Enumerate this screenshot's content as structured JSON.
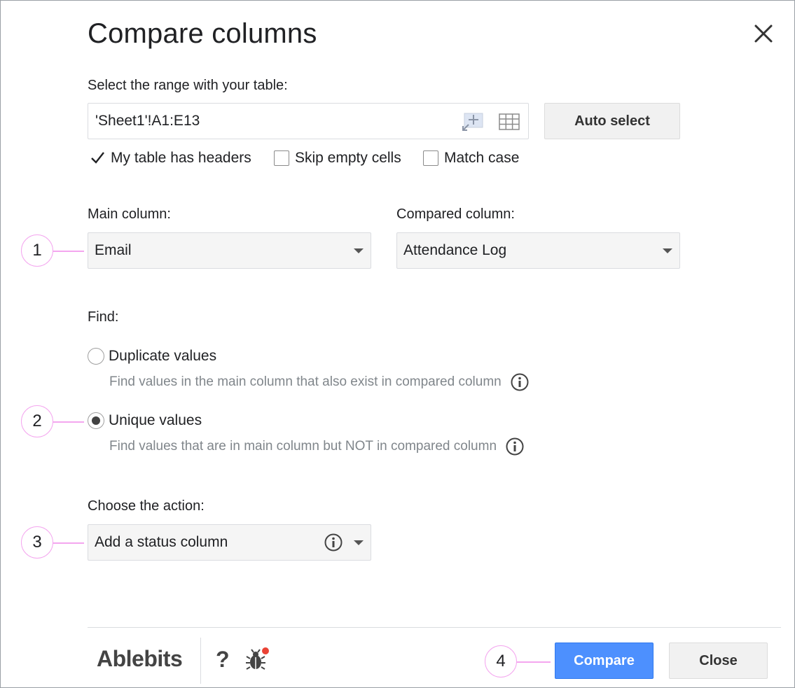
{
  "dialog": {
    "title": "Compare columns"
  },
  "range": {
    "label": "Select the range with your table:",
    "value": "'Sheet1'!A1:E13",
    "auto_select_label": "Auto select"
  },
  "options": {
    "has_headers": {
      "label": "My table has headers",
      "checked": true
    },
    "skip_empty": {
      "label": "Skip empty cells",
      "checked": false
    },
    "match_case": {
      "label": "Match case",
      "checked": false
    }
  },
  "columns": {
    "main_label": "Main column:",
    "main_value": "Email",
    "compared_label": "Compared column:",
    "compared_value": "Attendance Log"
  },
  "find": {
    "label": "Find:",
    "duplicate": {
      "label": "Duplicate values",
      "description": "Find values in the main column that also exist in compared column",
      "selected": false
    },
    "unique": {
      "label": "Unique values",
      "description": "Find values that are in main column but NOT in compared column",
      "selected": true
    }
  },
  "action": {
    "label": "Choose the action:",
    "value": "Add a status column"
  },
  "footer": {
    "brand": "Ablebits",
    "help": "?",
    "compare_label": "Compare",
    "close_label": "Close"
  },
  "callouts": [
    "1",
    "2",
    "3",
    "4"
  ],
  "colors": {
    "accent": "#4d90fe",
    "callout": "#f4a6ef",
    "bug_badge": "#ea4335"
  },
  "icons": [
    "close-icon",
    "range-picker-icon",
    "table-grid-icon",
    "checkmark-icon",
    "info-icon",
    "bug-icon"
  ]
}
